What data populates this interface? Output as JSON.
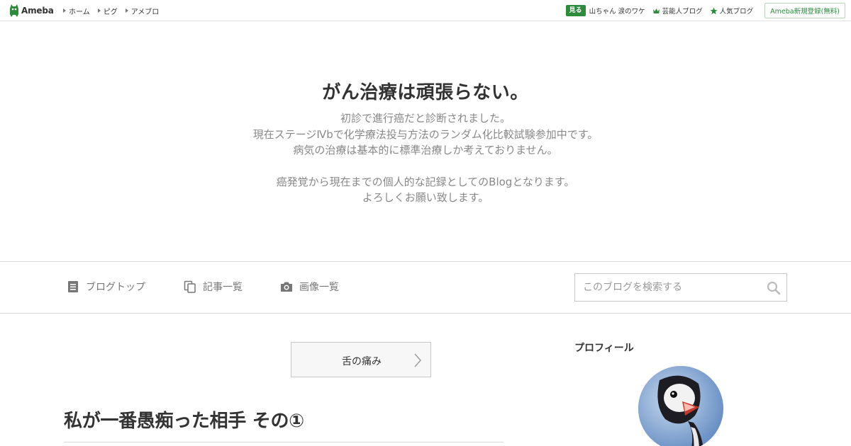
{
  "global_header": {
    "logo_text": "Ameba",
    "nav_links": [
      "ホーム",
      "ピグ",
      "アメブロ"
    ],
    "miru_badge": "見る",
    "miru_text": "山ちゃん 涙のワケ",
    "rank_links": [
      "芸能人ブログ",
      "人気ブログ"
    ],
    "register_label": "Ameba新規登録(無料)",
    "accent_color": "#2d8c3c"
  },
  "blog": {
    "title": "がん治療は頑張らない。",
    "description_lines": [
      "初診で進行癌だと診断されました。",
      "現在ステージⅣbで化学療法投与方法のランダム化比較試験参加中です。",
      "病気の治療は基本的に標準治療しか考えておりません。",
      "",
      "癌発覚から現在までの個人的な記録としてのBlogとなります。",
      "よろしくお願い致します。"
    ]
  },
  "blog_nav": {
    "items": [
      {
        "label": "ブログトップ",
        "icon": "document-icon"
      },
      {
        "label": "記事一覧",
        "icon": "copy-icon"
      },
      {
        "label": "画像一覧",
        "icon": "camera-icon"
      }
    ],
    "search_placeholder": "このブログを検索する",
    "search_icon": "search-icon"
  },
  "main": {
    "theme_label": "舌の痛み",
    "entry_title": "私が一番愚痴った相手 その①"
  },
  "sidebar": {
    "profile_heading": "プロフィール",
    "avatar_icon": "penguin-avatar"
  }
}
